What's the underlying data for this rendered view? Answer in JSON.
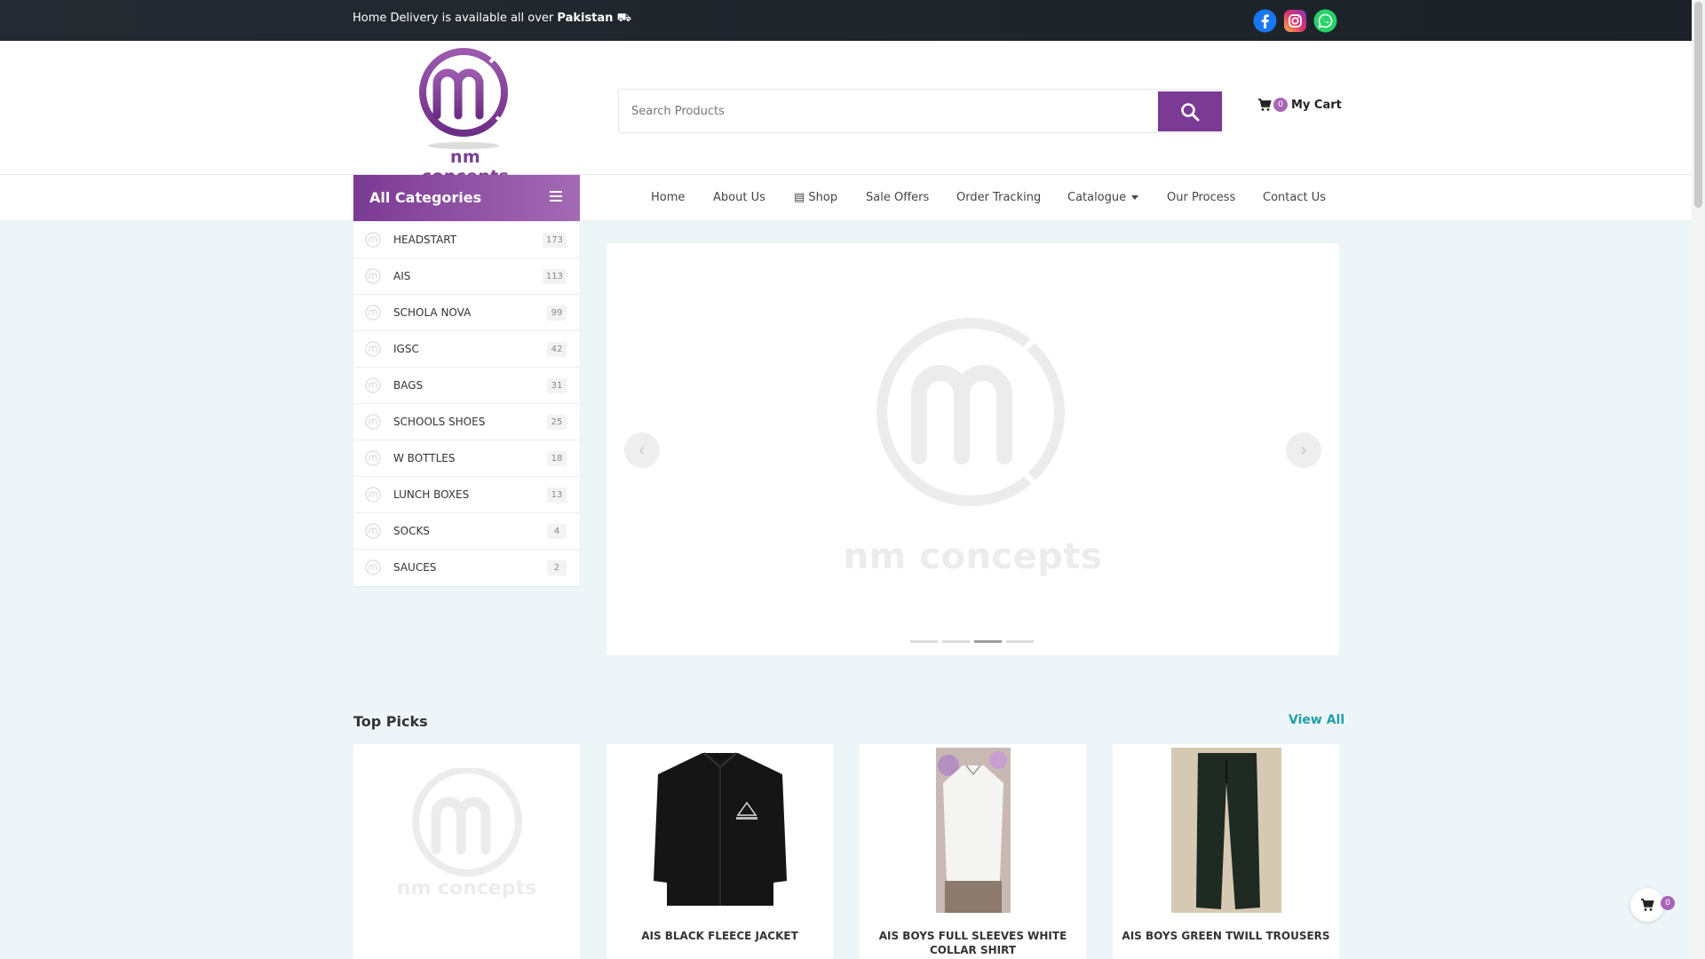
{
  "topbar": {
    "delivery_text": "Home Delivery is available all over ",
    "delivery_country": "Pakistan",
    "social": [
      "facebook-icon",
      "instagram-icon",
      "whatsapp-icon"
    ]
  },
  "brand": {
    "name": "nm concepts",
    "color": "#7b3a93",
    "accent": "#1fa1a6"
  },
  "search": {
    "placeholder": "Search Products",
    "value": ""
  },
  "cart": {
    "count": "0",
    "label": "My Cart"
  },
  "all_categories": {
    "label": "All Categories"
  },
  "nav": {
    "home": "Home",
    "about": "About Us",
    "shop": "Shop",
    "sale": "Sale Offers",
    "tracking": "Order Tracking",
    "catalogue": "Catalogue",
    "process": "Our Process",
    "contact": "Contact Us"
  },
  "categories": [
    {
      "label": "HEADSTART",
      "count": "173"
    },
    {
      "label": "AIS",
      "count": "113"
    },
    {
      "label": "SCHOLA NOVA",
      "count": "99"
    },
    {
      "label": "IGSC",
      "count": "42"
    },
    {
      "label": "BAGS",
      "count": "31"
    },
    {
      "label": "SCHOOLS SHOES",
      "count": "25"
    },
    {
      "label": "W BOTTLES",
      "count": "18"
    },
    {
      "label": "LUNCH BOXES",
      "count": "13"
    },
    {
      "label": "SOCKS",
      "count": "4"
    },
    {
      "label": "SAUCES",
      "count": "2"
    }
  ],
  "slider": {
    "prev": "‹",
    "next": "›",
    "slide_count": 4,
    "active_slide": 3
  },
  "top_picks": {
    "title": "Top Picks",
    "view_all": "View All",
    "products": [
      {
        "name": ""
      },
      {
        "name": "AIS BLACK FLEECE JACKET"
      },
      {
        "name": "AIS BOYS FULL SLEEVES WHITE COLLAR SHIRT"
      },
      {
        "name": "AIS BOYS GREEN TWILL TROUSERS"
      }
    ]
  },
  "floating_cart": {
    "count": "0"
  }
}
